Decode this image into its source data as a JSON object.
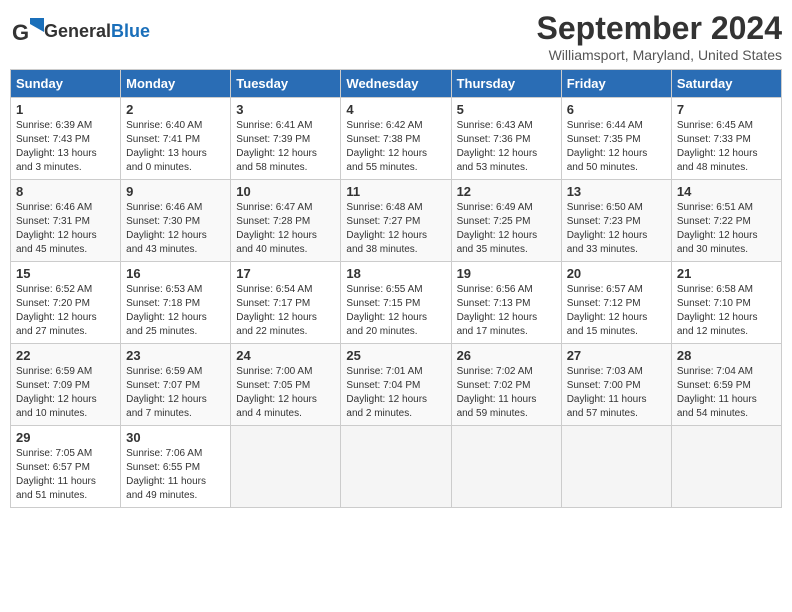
{
  "header": {
    "logo_general": "General",
    "logo_blue": "Blue",
    "month_title": "September 2024",
    "location": "Williamsport, Maryland, United States"
  },
  "days_of_week": [
    "Sunday",
    "Monday",
    "Tuesday",
    "Wednesday",
    "Thursday",
    "Friday",
    "Saturday"
  ],
  "weeks": [
    [
      {
        "day": "1",
        "info": "Sunrise: 6:39 AM\nSunset: 7:43 PM\nDaylight: 13 hours\nand 3 minutes."
      },
      {
        "day": "2",
        "info": "Sunrise: 6:40 AM\nSunset: 7:41 PM\nDaylight: 13 hours\nand 0 minutes."
      },
      {
        "day": "3",
        "info": "Sunrise: 6:41 AM\nSunset: 7:39 PM\nDaylight: 12 hours\nand 58 minutes."
      },
      {
        "day": "4",
        "info": "Sunrise: 6:42 AM\nSunset: 7:38 PM\nDaylight: 12 hours\nand 55 minutes."
      },
      {
        "day": "5",
        "info": "Sunrise: 6:43 AM\nSunset: 7:36 PM\nDaylight: 12 hours\nand 53 minutes."
      },
      {
        "day": "6",
        "info": "Sunrise: 6:44 AM\nSunset: 7:35 PM\nDaylight: 12 hours\nand 50 minutes."
      },
      {
        "day": "7",
        "info": "Sunrise: 6:45 AM\nSunset: 7:33 PM\nDaylight: 12 hours\nand 48 minutes."
      }
    ],
    [
      {
        "day": "8",
        "info": "Sunrise: 6:46 AM\nSunset: 7:31 PM\nDaylight: 12 hours\nand 45 minutes."
      },
      {
        "day": "9",
        "info": "Sunrise: 6:46 AM\nSunset: 7:30 PM\nDaylight: 12 hours\nand 43 minutes."
      },
      {
        "day": "10",
        "info": "Sunrise: 6:47 AM\nSunset: 7:28 PM\nDaylight: 12 hours\nand 40 minutes."
      },
      {
        "day": "11",
        "info": "Sunrise: 6:48 AM\nSunset: 7:27 PM\nDaylight: 12 hours\nand 38 minutes."
      },
      {
        "day": "12",
        "info": "Sunrise: 6:49 AM\nSunset: 7:25 PM\nDaylight: 12 hours\nand 35 minutes."
      },
      {
        "day": "13",
        "info": "Sunrise: 6:50 AM\nSunset: 7:23 PM\nDaylight: 12 hours\nand 33 minutes."
      },
      {
        "day": "14",
        "info": "Sunrise: 6:51 AM\nSunset: 7:22 PM\nDaylight: 12 hours\nand 30 minutes."
      }
    ],
    [
      {
        "day": "15",
        "info": "Sunrise: 6:52 AM\nSunset: 7:20 PM\nDaylight: 12 hours\nand 27 minutes."
      },
      {
        "day": "16",
        "info": "Sunrise: 6:53 AM\nSunset: 7:18 PM\nDaylight: 12 hours\nand 25 minutes."
      },
      {
        "day": "17",
        "info": "Sunrise: 6:54 AM\nSunset: 7:17 PM\nDaylight: 12 hours\nand 22 minutes."
      },
      {
        "day": "18",
        "info": "Sunrise: 6:55 AM\nSunset: 7:15 PM\nDaylight: 12 hours\nand 20 minutes."
      },
      {
        "day": "19",
        "info": "Sunrise: 6:56 AM\nSunset: 7:13 PM\nDaylight: 12 hours\nand 17 minutes."
      },
      {
        "day": "20",
        "info": "Sunrise: 6:57 AM\nSunset: 7:12 PM\nDaylight: 12 hours\nand 15 minutes."
      },
      {
        "day": "21",
        "info": "Sunrise: 6:58 AM\nSunset: 7:10 PM\nDaylight: 12 hours\nand 12 minutes."
      }
    ],
    [
      {
        "day": "22",
        "info": "Sunrise: 6:59 AM\nSunset: 7:09 PM\nDaylight: 12 hours\nand 10 minutes."
      },
      {
        "day": "23",
        "info": "Sunrise: 6:59 AM\nSunset: 7:07 PM\nDaylight: 12 hours\nand 7 minutes."
      },
      {
        "day": "24",
        "info": "Sunrise: 7:00 AM\nSunset: 7:05 PM\nDaylight: 12 hours\nand 4 minutes."
      },
      {
        "day": "25",
        "info": "Sunrise: 7:01 AM\nSunset: 7:04 PM\nDaylight: 12 hours\nand 2 minutes."
      },
      {
        "day": "26",
        "info": "Sunrise: 7:02 AM\nSunset: 7:02 PM\nDaylight: 11 hours\nand 59 minutes."
      },
      {
        "day": "27",
        "info": "Sunrise: 7:03 AM\nSunset: 7:00 PM\nDaylight: 11 hours\nand 57 minutes."
      },
      {
        "day": "28",
        "info": "Sunrise: 7:04 AM\nSunset: 6:59 PM\nDaylight: 11 hours\nand 54 minutes."
      }
    ],
    [
      {
        "day": "29",
        "info": "Sunrise: 7:05 AM\nSunset: 6:57 PM\nDaylight: 11 hours\nand 51 minutes."
      },
      {
        "day": "30",
        "info": "Sunrise: 7:06 AM\nSunset: 6:55 PM\nDaylight: 11 hours\nand 49 minutes."
      },
      {
        "day": "",
        "info": ""
      },
      {
        "day": "",
        "info": ""
      },
      {
        "day": "",
        "info": ""
      },
      {
        "day": "",
        "info": ""
      },
      {
        "day": "",
        "info": ""
      }
    ]
  ]
}
